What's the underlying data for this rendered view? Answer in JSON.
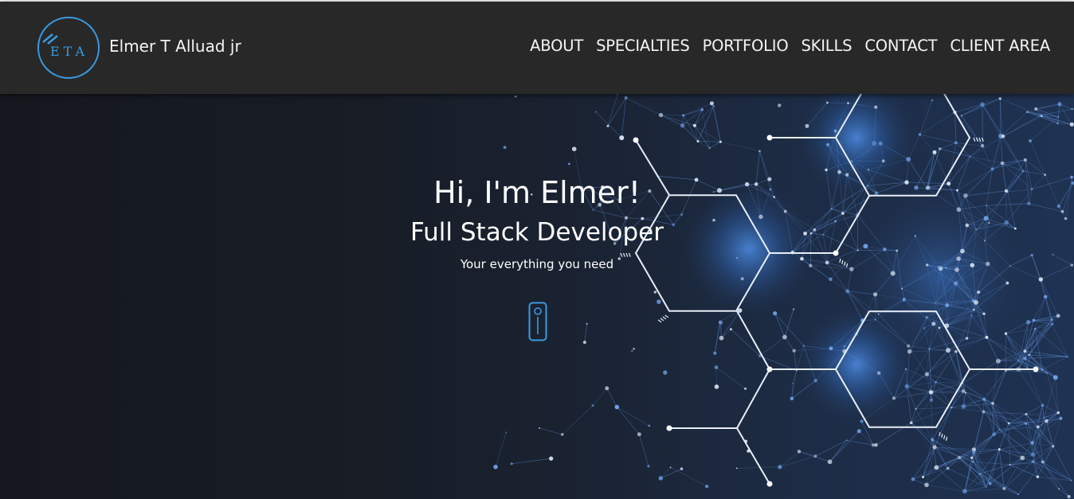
{
  "header": {
    "logo_text": "ETA",
    "brand_name": "Elmer T Alluad jr",
    "nav": [
      {
        "label": "ABOUT"
      },
      {
        "label": "SPECIALTIES"
      },
      {
        "label": "PORTFOLIO"
      },
      {
        "label": "SKILLS"
      },
      {
        "label": "CONTACT"
      },
      {
        "label": "CLIENT AREA"
      }
    ]
  },
  "hero": {
    "greeting": "Hi, I'm Elmer!",
    "role": "Full Stack Developer",
    "tagline": "Your everything you need",
    "scroll_icon": "mouse-scroll-icon"
  },
  "colors": {
    "navbar_bg": "#282828",
    "accent": "#3a9ae0",
    "hero_dark": "#15181e",
    "hero_blue": "#1f3252",
    "text": "#ffffff"
  }
}
